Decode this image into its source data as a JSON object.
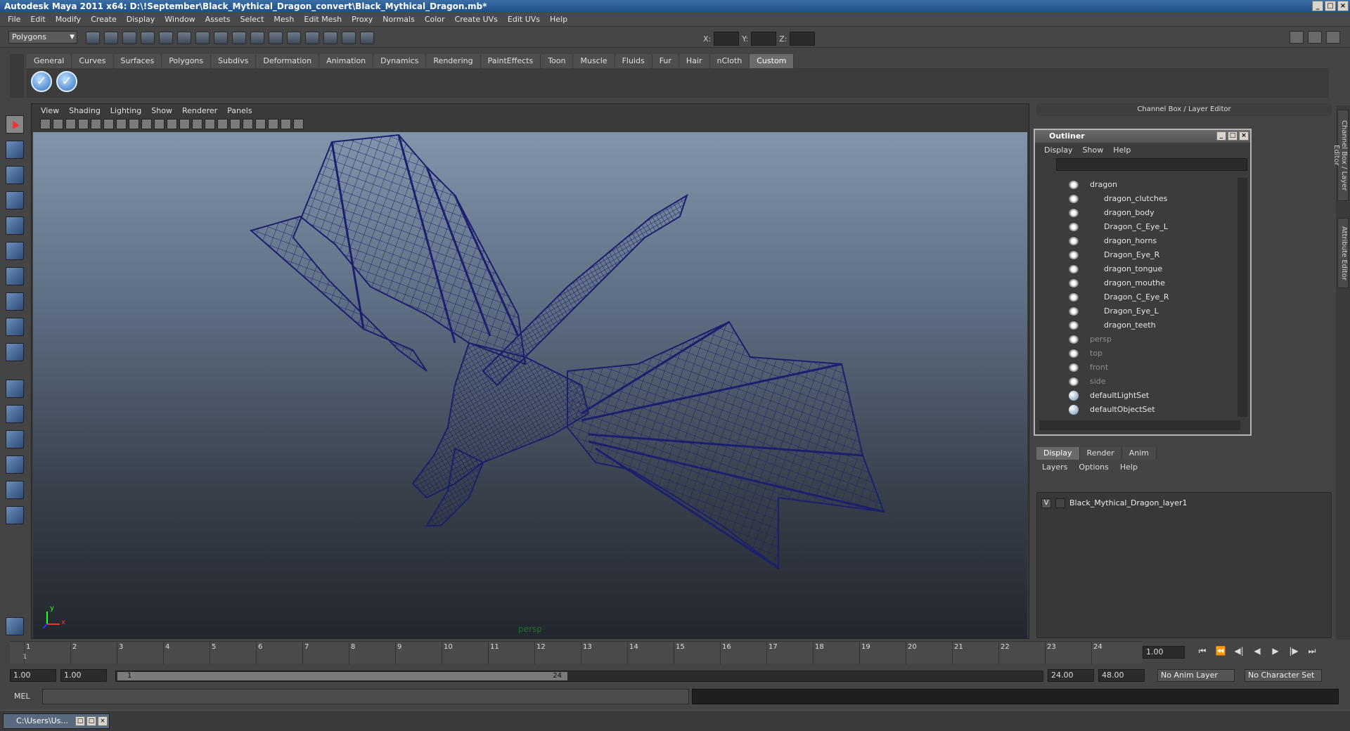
{
  "window": {
    "title": "Autodesk Maya 2011 x64: D:\\!September\\Black_Mythical_Dragon_convert\\Black_Mythical_Dragon.mb*"
  },
  "menus": [
    "File",
    "Edit",
    "Modify",
    "Create",
    "Display",
    "Window",
    "Assets",
    "Select",
    "Mesh",
    "Edit Mesh",
    "Proxy",
    "Normals",
    "Color",
    "Create UVs",
    "Edit UVs",
    "Help"
  ],
  "status": {
    "mode": "Polygons",
    "x_label": "X:",
    "y_label": "Y:",
    "z_label": "Z:"
  },
  "shelf": {
    "tabs": [
      "General",
      "Curves",
      "Surfaces",
      "Polygons",
      "Subdivs",
      "Deformation",
      "Animation",
      "Dynamics",
      "Rendering",
      "PaintEffects",
      "Toon",
      "Muscle",
      "Fluids",
      "Fur",
      "Hair",
      "nCloth",
      "Custom"
    ],
    "active": "Custom"
  },
  "viewport": {
    "menus": [
      "View",
      "Shading",
      "Lighting",
      "Show",
      "Renderer",
      "Panels"
    ],
    "camera": "persp",
    "axis_y": "y",
    "axis_x": "x"
  },
  "channel_box": {
    "title": "Channel Box / Layer Editor",
    "side_tab_1": "Channel Box / Layer Editor",
    "side_tab_2": "Attribute Editor"
  },
  "outliner": {
    "title": "Outliner",
    "menus": [
      "Display",
      "Show",
      "Help"
    ],
    "items": [
      {
        "label": "dragon",
        "type": "group"
      },
      {
        "label": "dragon_clutches",
        "type": "child"
      },
      {
        "label": "dragon_body",
        "type": "child"
      },
      {
        "label": "Dragon_C_Eye_L",
        "type": "child"
      },
      {
        "label": "dragon_horns",
        "type": "child"
      },
      {
        "label": "Dragon_Eye_R",
        "type": "child"
      },
      {
        "label": "dragon_tongue",
        "type": "child"
      },
      {
        "label": "dragon_mouthe",
        "type": "child"
      },
      {
        "label": "Dragon_C_Eye_R",
        "type": "child"
      },
      {
        "label": "Dragon_Eye_L",
        "type": "child"
      },
      {
        "label": "dragon_teeth",
        "type": "child"
      },
      {
        "label": "persp",
        "type": "camera"
      },
      {
        "label": "top",
        "type": "camera"
      },
      {
        "label": "front",
        "type": "camera"
      },
      {
        "label": "side",
        "type": "camera"
      },
      {
        "label": "defaultLightSet",
        "type": "set"
      },
      {
        "label": "defaultObjectSet",
        "type": "set"
      }
    ]
  },
  "layers": {
    "tabs": [
      "Display",
      "Render",
      "Anim"
    ],
    "active_tab": "Display",
    "menus": [
      "Layers",
      "Options",
      "Help"
    ],
    "rows": [
      {
        "visible": "V",
        "name": "Black_Mythical_Dragon_layer1"
      }
    ]
  },
  "timeline": {
    "ticks": [
      "1",
      "2",
      "3",
      "4",
      "5",
      "6",
      "7",
      "8",
      "9",
      "10",
      "11",
      "12",
      "13",
      "14",
      "15",
      "16",
      "17",
      "18",
      "19",
      "20",
      "21",
      "22",
      "23",
      "24"
    ],
    "current_marker": "1",
    "current_frame": "1.00"
  },
  "range": {
    "start": "1.00",
    "playback_start": "1.00",
    "handle_start": "1",
    "handle_end": "24",
    "playback_end": "24.00",
    "end": "48.00",
    "anim_layer": "No Anim Layer",
    "character_set": "No Character Set"
  },
  "cmd": {
    "label": "MEL"
  },
  "taskbar": {
    "item": "C:\\Users\\Us..."
  }
}
